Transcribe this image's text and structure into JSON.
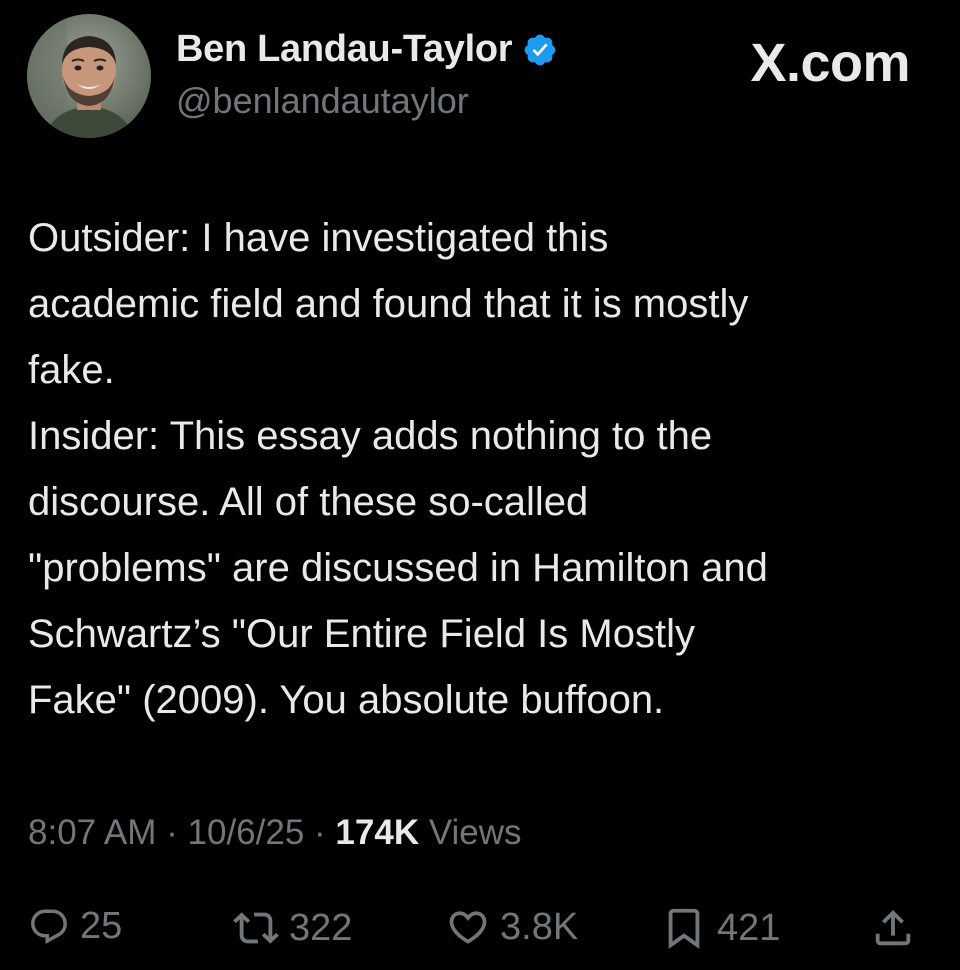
{
  "author": {
    "display_name": "Ben Landau-Taylor",
    "handle": "@benlandautaylor",
    "verified": true,
    "verified_color": "#1d9bf0",
    "avatar_icon": "profile-photo"
  },
  "site_label": "X.com",
  "tweet": {
    "lines": [
      "Outsider: I have investigated this",
      "academic field and found that it is mostly",
      "fake.",
      "Insider: This essay adds nothing to the",
      "discourse. All of these so-called",
      "\"problems\" are discussed in Hamilton and",
      "Schwartz’s \"Our Entire Field Is Mostly",
      "Fake\" (2009). You absolute buffoon."
    ]
  },
  "meta": {
    "time": "8:07 AM",
    "separator": " · ",
    "date": "10/6/25",
    "views_count": "174K",
    "views_label": " Views"
  },
  "actions": {
    "reply": {
      "icon": "reply-icon",
      "count": "25"
    },
    "repost": {
      "icon": "repost-icon",
      "count": "322"
    },
    "like": {
      "icon": "heart-icon",
      "count": "3.8K"
    },
    "bookmark": {
      "icon": "bookmark-icon",
      "count": "421"
    },
    "share": {
      "icon": "share-icon"
    }
  },
  "colors": {
    "background": "#000000",
    "text_primary": "#e7e9ea",
    "text_secondary": "#71767b"
  }
}
